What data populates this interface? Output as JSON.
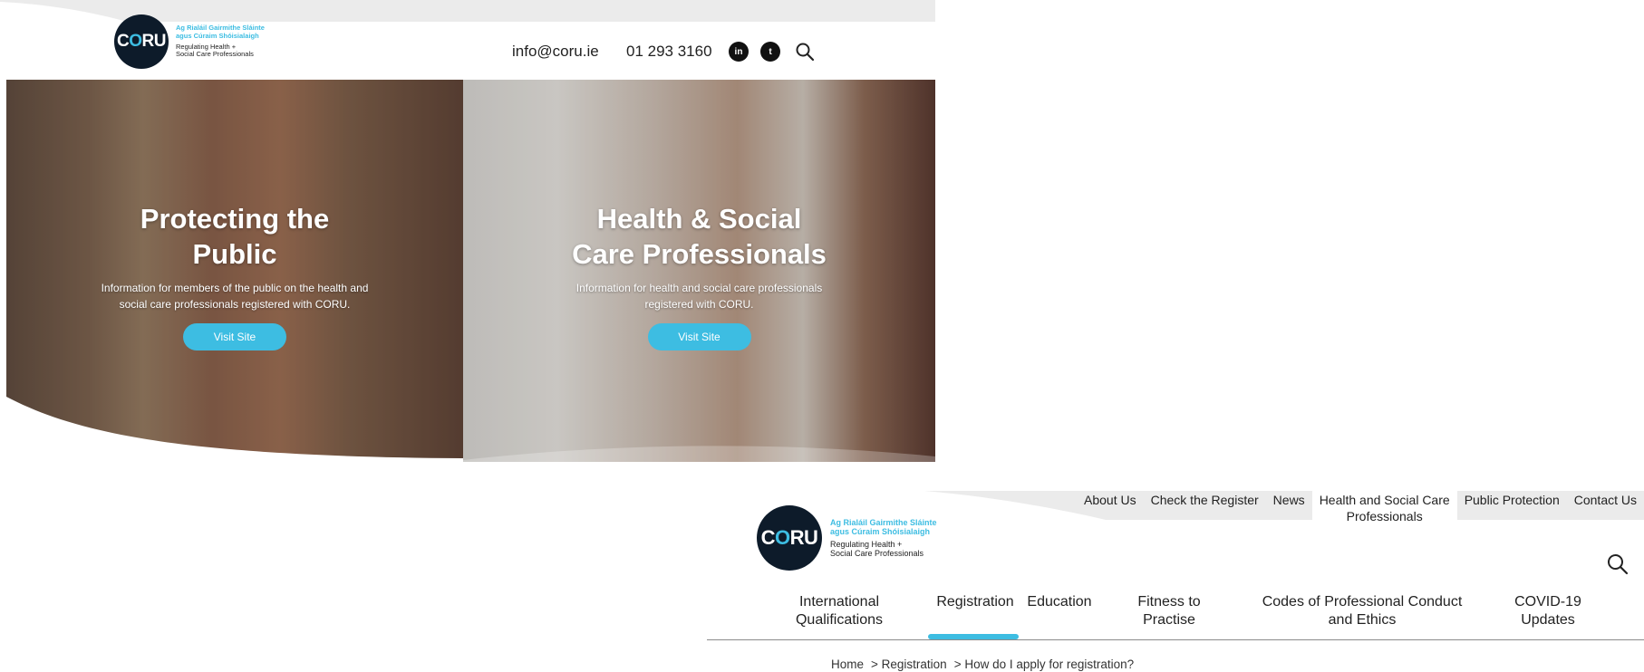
{
  "brand": {
    "logo_word_before": "C",
    "logo_word_o": "O",
    "logo_word_after": "RU",
    "irish_line1": "Ag Rialáil Gairmithe Sláinte",
    "irish_line2": "agus Cúraim Shóisialaigh",
    "english_line1": "Regulating Health +",
    "english_line2": "Social Care Professionals",
    "accent_color": "#3dbde2",
    "dark_color": "#0d1b2a"
  },
  "screen1": {
    "header": {
      "email": "info@coru.ie",
      "phone": "01 293 3160",
      "social_linkedin_glyph": "in",
      "social_twitter_glyph": "t",
      "search_icon": "search-icon"
    },
    "hero_left": {
      "title": "Protecting the Public",
      "description": "Information for members of the public on the health and social care professionals registered with CORU.",
      "button": "Visit Site"
    },
    "hero_right": {
      "title": "Health & Social Care Professionals",
      "description": "Information for health and social care professionals registered with CORU.",
      "button": "Visit Site"
    }
  },
  "screen2": {
    "top_nav": [
      {
        "label": "About Us"
      },
      {
        "label": "Check the Register"
      },
      {
        "label": "News"
      },
      {
        "label": "Health and Social Care Professionals",
        "active": true
      },
      {
        "label": "Public Protection"
      },
      {
        "label": "Contact Us"
      }
    ],
    "main_nav": [
      {
        "label": "International Qualifications"
      },
      {
        "label": "Registration",
        "active": true
      },
      {
        "label": "Education"
      },
      {
        "label": "Fitness to Practise"
      },
      {
        "label": "Codes of Professional Conduct and Ethics"
      },
      {
        "label": "COVID-19 Updates"
      }
    ],
    "breadcrumb": [
      {
        "label": "Home"
      },
      {
        "label": "> Registration"
      },
      {
        "label": "> How do I apply for registration?"
      }
    ],
    "search_icon": "search-icon"
  }
}
